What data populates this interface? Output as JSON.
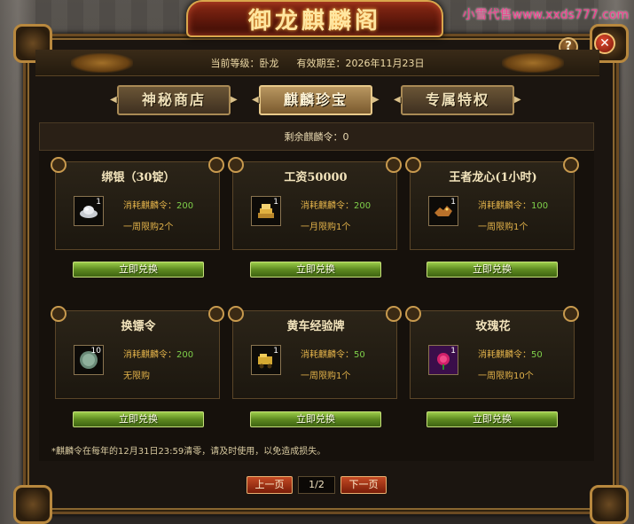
{
  "window": {
    "title": "御龙麒麟阁",
    "help_label": "?",
    "close_label": "✕"
  },
  "watermark": "小雪代售www.xxds777.com",
  "header": {
    "level_label": "当前等级：卧龙",
    "expiry_label": "有效期至：2026年11月23日"
  },
  "tabs": [
    {
      "label": "神秘商店",
      "active": false
    },
    {
      "label": "麒麟珍宝",
      "active": true
    },
    {
      "label": "专属特权",
      "active": false
    }
  ],
  "remaining": "剩余麒麟令：0",
  "cost_prefix": "消耗麒麟令：",
  "items": [
    {
      "name": "绑银（30锭）",
      "qty": "1",
      "cost": "200",
      "limit": "一周限购2个",
      "button": "立即兑换",
      "icon": "silver-ingot-icon"
    },
    {
      "name": "工资50000",
      "qty": "1",
      "cost": "200",
      "limit": "一月限购1个",
      "button": "立即兑换",
      "icon": "gold-stack-icon"
    },
    {
      "name": "王者龙心(1小时)",
      "qty": "1",
      "cost": "100",
      "limit": "一周限购1个",
      "button": "立即兑换",
      "icon": "dragon-heart-icon"
    },
    {
      "name": "换镖令",
      "qty": "10",
      "cost": "200",
      "limit": "无限购",
      "button": "立即兑换",
      "icon": "token-icon"
    },
    {
      "name": "黄车经验牌",
      "qty": "1",
      "cost": "50",
      "limit": "一周限购1个",
      "button": "立即兑换",
      "icon": "cart-plaque-icon"
    },
    {
      "name": "玫瑰花",
      "qty": "1",
      "cost": "50",
      "limit": "一周限购10个",
      "button": "立即兑换",
      "icon": "rose-icon"
    }
  ],
  "note": "*麒麟令在每年的12月31日23:59清零，请及时使用，以免造成损失。",
  "pager": {
    "prev": "上一页",
    "page": "1/2",
    "next": "下一页"
  },
  "colors": {
    "accent_gold": "#e2b24a",
    "cost_value": "#7fd04a",
    "button_green": "#5d8a20"
  }
}
